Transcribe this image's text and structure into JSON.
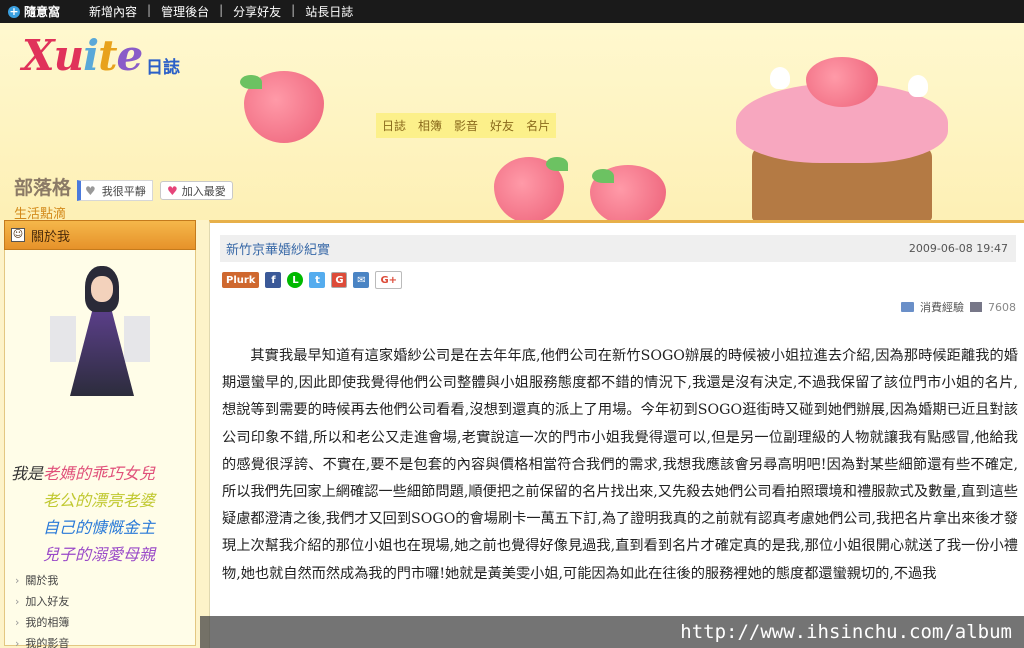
{
  "topbar": {
    "brand": "隨意窩",
    "links": [
      "新增內容",
      "管理後台",
      "分享好友",
      "站長日誌"
    ]
  },
  "header": {
    "logo_text": "Xuite",
    "logo_sub": "日誌",
    "nav": [
      "日誌",
      "相簿",
      "影音",
      "好友",
      "名片"
    ],
    "blog_title": "部落格",
    "blog_sub": "生活點滴",
    "mood_label": "我很平靜",
    "fav_label": "加入最愛"
  },
  "sidebar": {
    "title": "關於我",
    "quotes": [
      {
        "prefix": "我是",
        "text": "老媽的乖巧女兒",
        "color": "#e0507a"
      },
      {
        "prefix": "",
        "text": "老公的漂亮老婆",
        "color": "#c0c830"
      },
      {
        "prefix": "",
        "text": "自己的慷慨金主",
        "color": "#2a7ad8"
      },
      {
        "prefix": "",
        "text": "兒子的溺愛母親",
        "color": "#9a4ac8"
      }
    ],
    "links": [
      "關於我",
      "加入好友",
      "我的相簿",
      "我的影音"
    ]
  },
  "post": {
    "title": "新竹京華婚紗紀實",
    "date": "2009-06-08 19:47",
    "share": [
      "Plurk",
      "f",
      "L",
      "t",
      "G",
      "✉",
      "G+"
    ],
    "category": "消費經驗",
    "views": "7608",
    "body": "其實我最早知道有這家婚紗公司是在去年年底,他們公司在新竹SOGO辦展的時候被小姐拉進去介紹,因為那時候距離我的婚期還蠻早的,因此即使我覺得他們公司整體與小姐服務態度都不錯的情況下,我還是沒有決定,不過我保留了該位門市小姐的名片,想說等到需要的時候再去他們公司看看,沒想到還真的派上了用場。今年初到SOGO逛街時又碰到她們辦展,因為婚期已近且對該公司印象不錯,所以和老公又走進會場,老實說這一次的門市小姐我覺得還可以,但是另一位副理級的人物就讓我有點感冒,他給我的感覺很浮誇、不實在,要不是包套的內容與價格相當符合我們的需求,我想我應該會另尋高明吧!因為對某些細節還有些不確定,所以我們先回家上網確認一些細節問題,順便把之前保留的名片找出來,又先殺去她們公司看拍照環境和禮服款式及數量,直到這些疑慮都澄清之後,我們才又回到SOGO的會場刷卡一萬五下訂,為了證明我真的之前就有認真考慮她們公司,我把名片拿出來後才發現上次幫我介紹的那位小姐也在現場,她之前也覺得好像見過我,直到看到名片才確定真的是我,那位小姐很開心就送了我一份小禮物,她也就自然而然成為我的門市囉!她就是黃美雯小姐,可能因為如此在往後的服務裡她的態度都還蠻親切的,不過我"
  },
  "watermark": "http://www.ihsinchu.com/album"
}
